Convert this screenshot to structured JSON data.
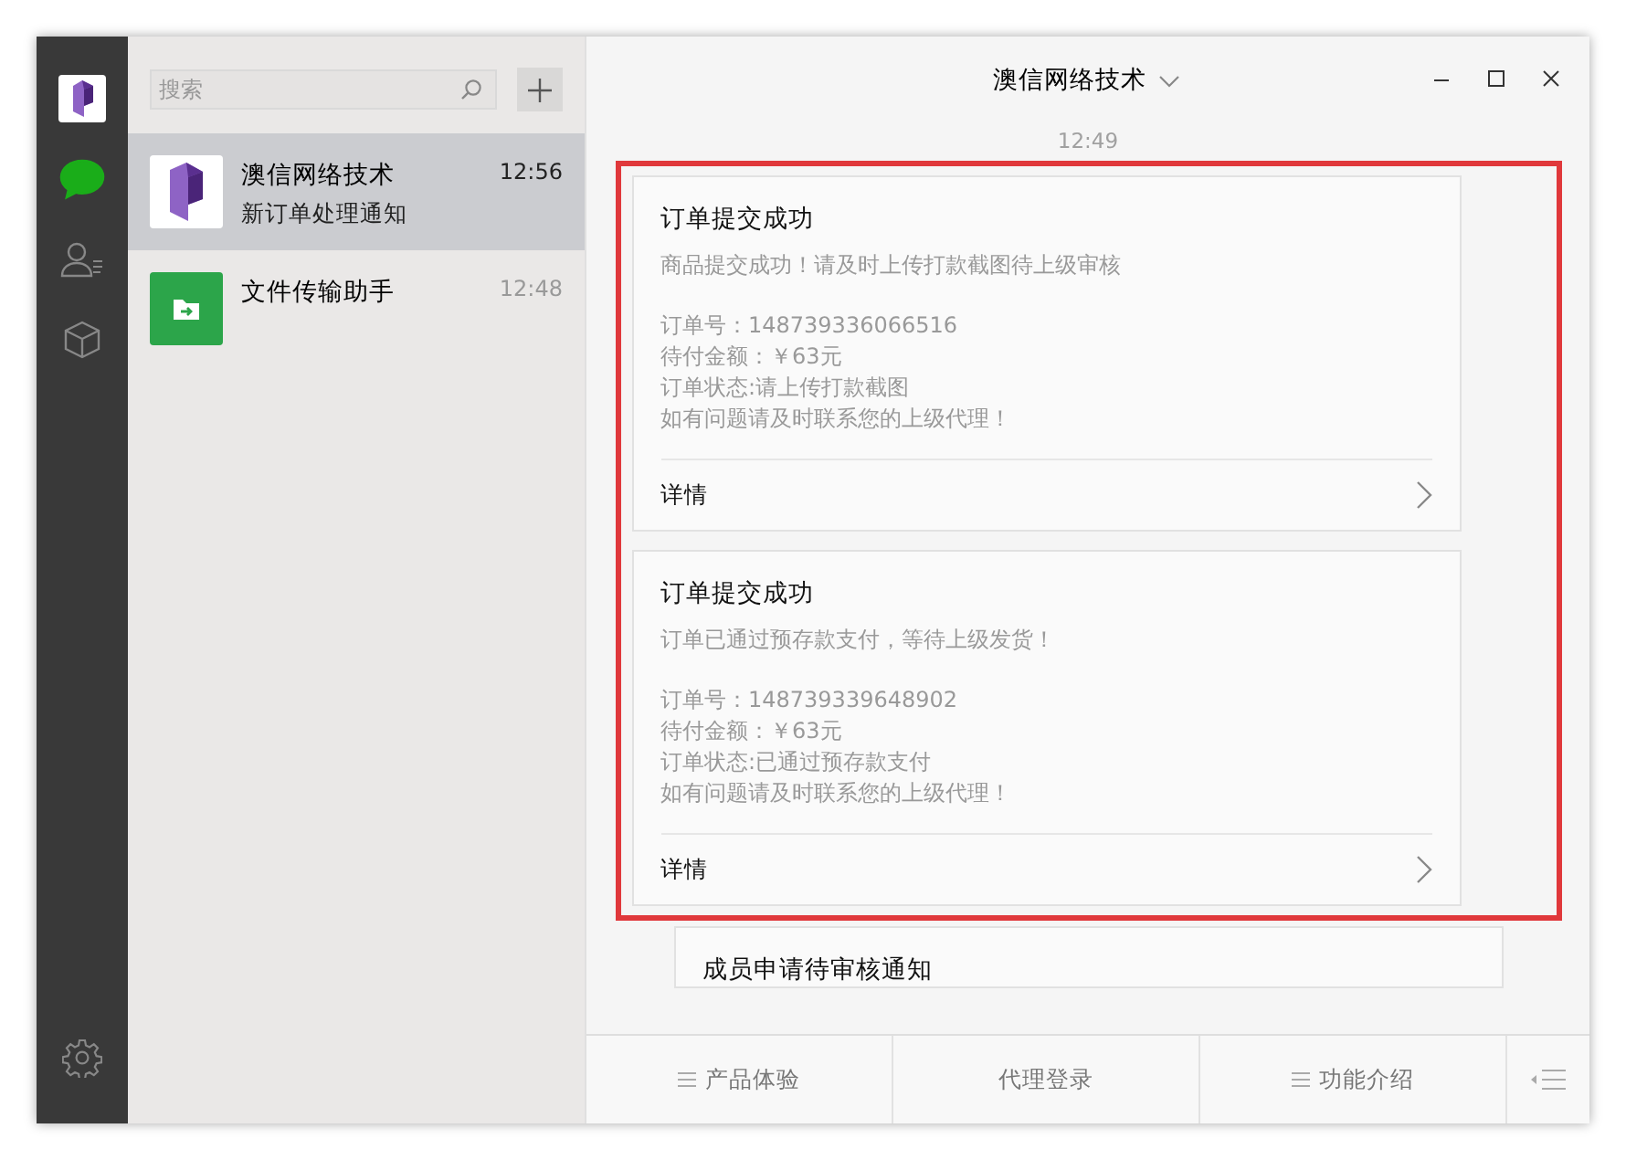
{
  "nav": [
    {
      "kind": "avatar"
    },
    {
      "kind": "chats",
      "selected": true
    },
    {
      "kind": "contacts",
      "selected": false
    },
    {
      "kind": "favorites",
      "selected": false
    },
    {
      "kind": "settings",
      "selected": false
    }
  ],
  "search": {
    "placeholder": "搜索"
  },
  "chats": [
    {
      "kind": "brand",
      "name": "澳信网络技术",
      "preview": "新订单处理通知",
      "time": "12:56",
      "selected": true
    },
    {
      "kind": "file",
      "name": "文件传输助手",
      "time": "12:48",
      "selected": false
    }
  ],
  "conversation": {
    "title": "澳信网络技术",
    "timestamp": "12:49",
    "cards": [
      {
        "title": "订单提交成功",
        "summary": "商品提交成功！请及时上传打款截图待上级审核",
        "lines": [
          "订单号：148739336066516",
          "待付金额：￥63元",
          "订单状态:请上传打款截图",
          "如有问题请及时联系您的上级代理！"
        ],
        "link": "详情",
        "highlighted": true
      },
      {
        "title": "订单提交成功",
        "summary": "订单已通过预存款支付，等待上级发货！",
        "lines": [
          "订单号：148739339648902",
          "待付金额：￥63元",
          "订单状态:已通过预存款支付",
          "如有问题请及时联系您的上级代理！"
        ],
        "link": "详情",
        "highlighted": true
      },
      {
        "title": "成员申请待审核通知",
        "highlighted": false
      }
    ],
    "menu": [
      {
        "kind": "submenu",
        "label": "产品体验"
      },
      {
        "kind": "link",
        "label": "代理登录"
      },
      {
        "kind": "submenu",
        "label": "功能介绍"
      }
    ]
  }
}
